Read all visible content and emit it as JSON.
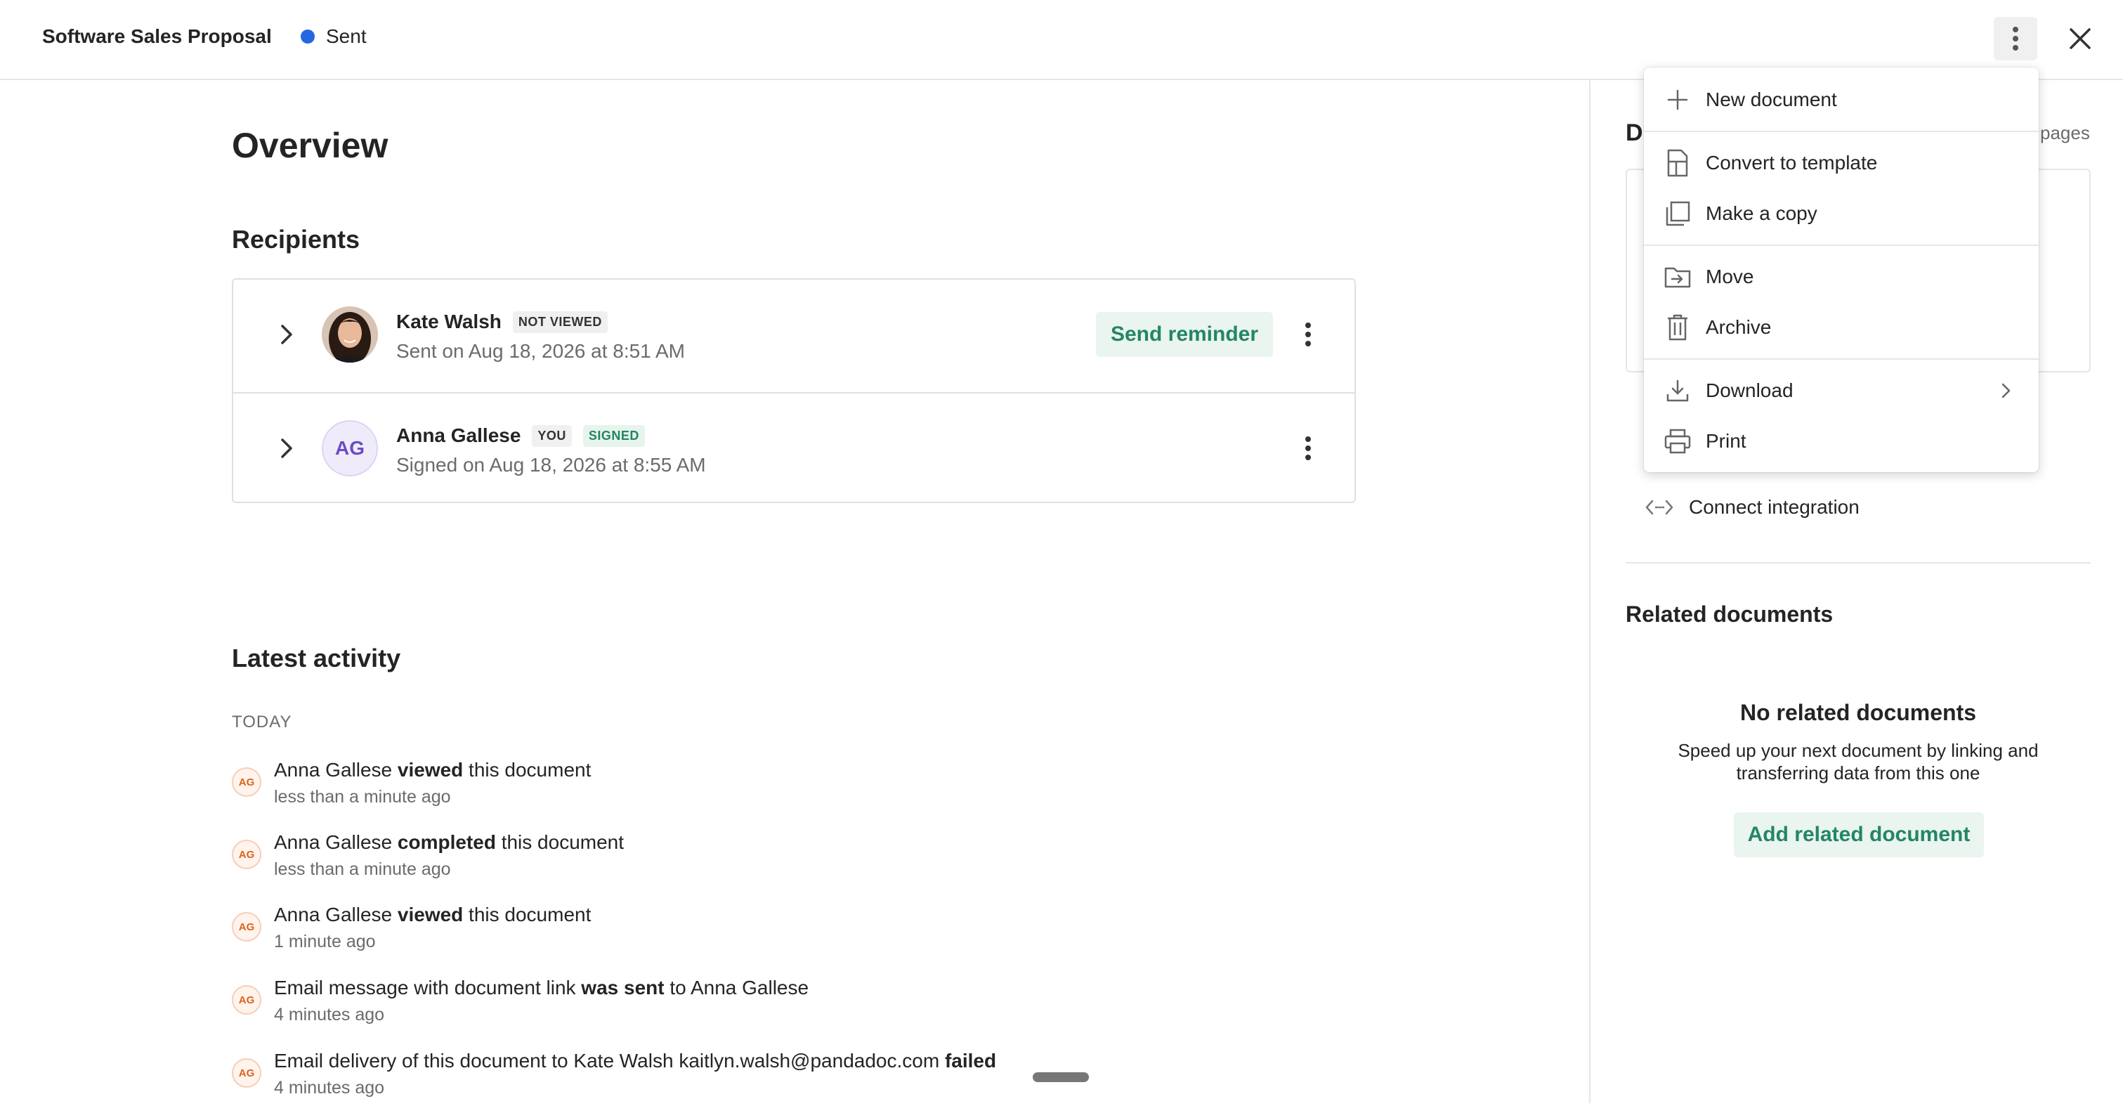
{
  "header": {
    "doc_title": "Software Sales Proposal",
    "status_label": "Sent",
    "status_color": "#2567e0"
  },
  "main": {
    "overview_title": "Overview",
    "recipients_title": "Recipients",
    "recipients": [
      {
        "name": "Kate Walsh",
        "badges": [
          "NOT VIEWED"
        ],
        "subtitle": "Sent on Aug 18, 2026 at 8:51 AM",
        "action_label": "Send reminder"
      },
      {
        "name": "Anna Gallese",
        "initials": "AG",
        "badges": [
          "YOU",
          "SIGNED"
        ],
        "subtitle": "Signed on Aug 18, 2026 at 8:55 AM"
      }
    ],
    "activity_title": "Latest activity",
    "activity_group": "TODAY",
    "activities": [
      {
        "initials": "AG",
        "pre": "Anna Gallese ",
        "bold": "viewed",
        "post": " this document",
        "time": "less than a minute ago"
      },
      {
        "initials": "AG",
        "pre": "Anna Gallese ",
        "bold": "completed",
        "post": " this document",
        "time": "less than a minute ago"
      },
      {
        "initials": "AG",
        "pre": "Anna Gallese ",
        "bold": "viewed",
        "post": " this document",
        "time": "1 minute ago"
      },
      {
        "initials": "AG",
        "pre": "Email message with document link ",
        "bold": "was sent",
        "post": " to Anna Gallese",
        "time": "4 minutes ago"
      },
      {
        "initials": "AG",
        "pre": "Email delivery of this document to Kate Walsh kaitlyn.walsh@pandadoc.com ",
        "bold": "failed",
        "post": "",
        "time": "4 minutes ago"
      }
    ]
  },
  "sidebar": {
    "partial_title": "D",
    "pages_label": "pages",
    "connect_integration": "Connect integration",
    "related_title": "Related documents",
    "no_related_title": "No related documents",
    "no_related_text": "Speed up your next document by linking and transferring data from this one",
    "add_related_label": "Add related document"
  },
  "menu": {
    "items": [
      {
        "label": "New document",
        "icon": "plus-icon"
      },
      {
        "label": "Convert to template",
        "icon": "template-icon"
      },
      {
        "label": "Make a copy",
        "icon": "copy-icon"
      },
      {
        "label": "Move",
        "icon": "move-folder-icon"
      },
      {
        "label": "Archive",
        "icon": "archive-icon"
      },
      {
        "label": "Download",
        "icon": "download-icon"
      },
      {
        "label": "Print",
        "icon": "print-icon"
      }
    ]
  },
  "colors": {
    "accent_green": "#248567",
    "accent_green_bg": "#e9f5ee",
    "status_blue": "#2567e0"
  }
}
